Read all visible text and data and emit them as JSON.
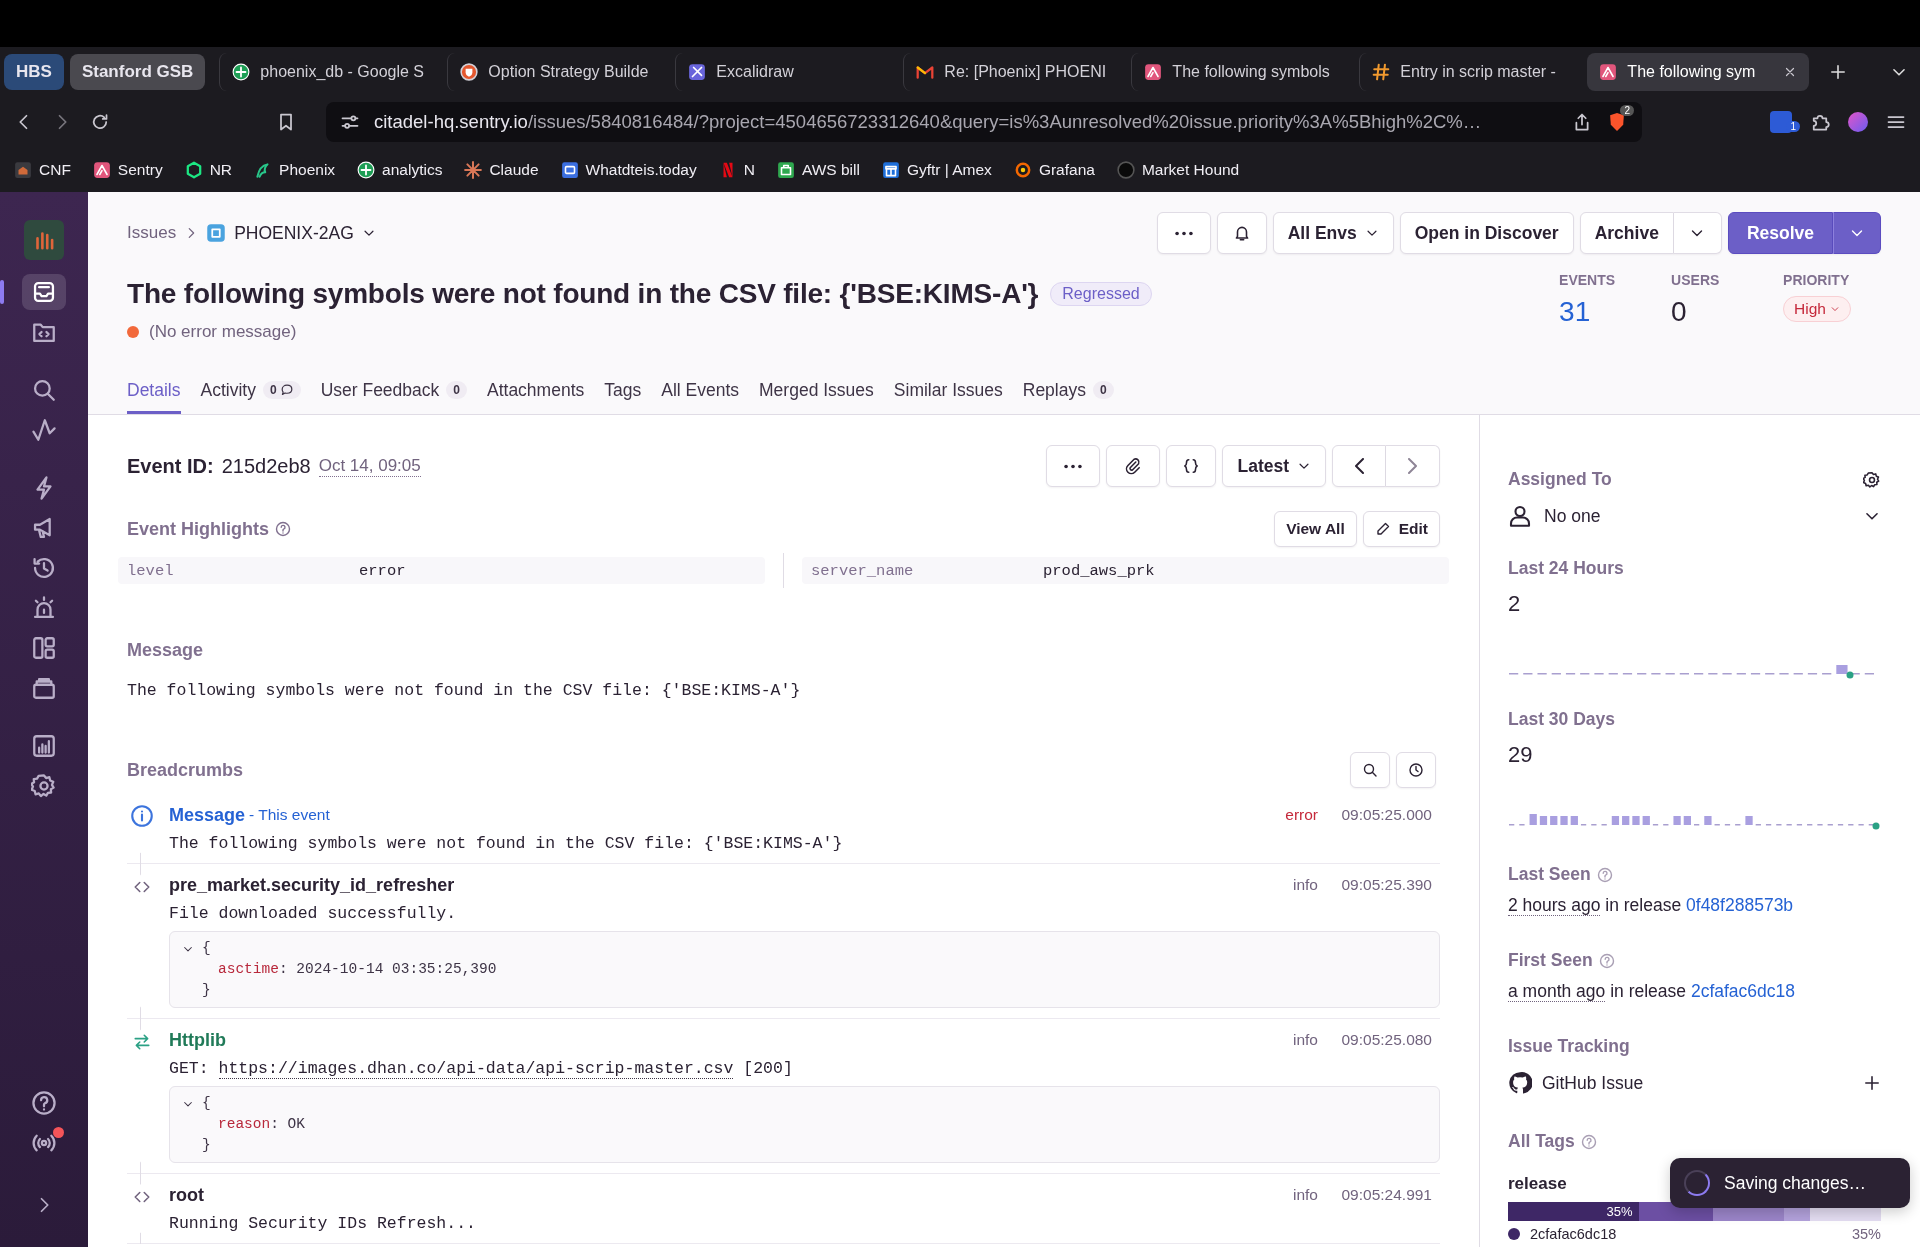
{
  "browser": {
    "tab_groups": [
      {
        "label": "HBS",
        "color": "#2b4a78"
      },
      {
        "label": "Stanford GSB",
        "color": "#4a494f"
      }
    ],
    "tabs": [
      {
        "title": "phoenix_db - Google S",
        "kind": "sheet",
        "selected": false
      },
      {
        "title": "Option Strategy Builde",
        "kind": "shield",
        "selected": false
      },
      {
        "title": "Excalidraw",
        "kind": "draw",
        "selected": false
      },
      {
        "title": "Re: [Phoenix] PHOENI",
        "kind": "mail",
        "selected": false
      },
      {
        "title": "The following symbols",
        "kind": "sentry",
        "selected": false
      },
      {
        "title": "Entry in scrip master -",
        "kind": "hash",
        "selected": false
      },
      {
        "title": "The following sym",
        "kind": "sentry",
        "selected": true
      }
    ],
    "address": {
      "host": "citadel-hq.sentry.io",
      "path": "/issues/5840816484/?project=4504656723312640&query=is%3Aunresolved%20issue.priority%3A%5Bhigh%2C%…"
    },
    "shield_badge": "2",
    "extension_badge": "1",
    "bookmarks": [
      {
        "label": "CNF",
        "kind": "house"
      },
      {
        "label": "Sentry",
        "kind": "sentry"
      },
      {
        "label": "NR",
        "kind": "nr"
      },
      {
        "label": "Phoenix",
        "kind": "phoenix"
      },
      {
        "label": "analytics",
        "kind": "sheet"
      },
      {
        "label": "Claude",
        "kind": "star"
      },
      {
        "label": "Whatdteis.today",
        "kind": "square"
      },
      {
        "label": "N",
        "kind": "redbar"
      },
      {
        "label": "AWS bill",
        "kind": "aws"
      },
      {
        "label": "Gyftr | Amex",
        "kind": "gift"
      },
      {
        "label": "Grafana",
        "kind": "gear"
      },
      {
        "label": "Market Hound",
        "kind": "circle"
      }
    ]
  },
  "sidebar": {
    "items": [
      {
        "kind": "issues",
        "selected": true
      },
      {
        "kind": "code",
        "selected": false
      },
      {
        "kind": "search",
        "selected": false
      },
      {
        "kind": "trend",
        "selected": false
      },
      {
        "kind": "bolt",
        "selected": false
      },
      {
        "kind": "megaphone",
        "selected": false
      },
      {
        "kind": "history",
        "selected": false
      },
      {
        "kind": "siren",
        "selected": false
      },
      {
        "kind": "panels",
        "selected": false
      },
      {
        "kind": "stack",
        "selected": false
      },
      {
        "kind": "chart",
        "selected": false
      },
      {
        "kind": "settings",
        "selected": false
      }
    ],
    "footer": [
      {
        "kind": "help",
        "alert": false
      },
      {
        "kind": "broadcast",
        "alert": true
      },
      {
        "kind": "expand",
        "alert": false
      }
    ]
  },
  "header": {
    "breadcrumb": "Issues",
    "issue_id": "PHOENIX-2AG",
    "environment": "All Envs",
    "buttons": [
      "Open in Discover",
      "Archive"
    ],
    "primary": "Resolve",
    "title": "The following symbols were not found in the CSV file: {'BSE:KIMS-A'}",
    "status": "Regressed",
    "subtitle": "(No error message)",
    "stats": [
      {
        "label": "EVENTS",
        "value": "31",
        "kind": "link"
      },
      {
        "label": "USERS",
        "value": "0",
        "kind": "plain"
      }
    ],
    "priority": {
      "label": "PRIORITY",
      "value": "High"
    }
  },
  "tabs": [
    {
      "label": "Details",
      "selected": true
    },
    {
      "label": "Activity",
      "count": "0",
      "kind": "comment",
      "selected": false
    },
    {
      "label": "User Feedback",
      "count": "0",
      "selected": false
    },
    {
      "label": "Attachments",
      "selected": false
    },
    {
      "label": "Tags",
      "selected": false
    },
    {
      "label": "All Events",
      "selected": false
    },
    {
      "label": "Merged Issues",
      "selected": false
    },
    {
      "label": "Similar Issues",
      "selected": false
    },
    {
      "label": "Replays",
      "count": "0",
      "selected": false
    }
  ],
  "event": {
    "id_label": "Event ID:",
    "id": "215d2eb8",
    "date": "Oct 14, 09:05",
    "selector": "Latest",
    "highlights_title": "Event Highlights",
    "highlight_buttons": [
      "View All",
      "Edit"
    ],
    "highlights": [
      {
        "key": "level",
        "value": "error"
      },
      {
        "key": "server_name",
        "value": "prod_aws_prk"
      }
    ],
    "message_title": "Message",
    "message": "The following symbols were not found in the CSV file: {'BSE:KIMS-A'}",
    "breadcrumbs_title": "Breadcrumbs",
    "breadcrumbs": [
      {
        "kind": "message",
        "title": "Message",
        "note": " - This event",
        "level": "error",
        "time": "09:05:25.000",
        "text": "The following symbols were not found in the CSV file: {'BSE:KIMS-A'}"
      },
      {
        "kind": "log",
        "title": "pre_market.security_id_refresher",
        "level": "info",
        "time": "09:05:25.390",
        "text": "File downloaded successfully.",
        "data": {
          "open": "{",
          "close": "}",
          "entries": [
            {
              "key": "asctime",
              "separator": ":",
              "value": "2024-10-14 03:35:25,390"
            }
          ]
        }
      },
      {
        "kind": "http",
        "title": "Httplib",
        "level": "info",
        "time": "09:05:25.080",
        "method": "GET: ",
        "url": "https://images.dhan.co/api-data/api-scrip-master.csv",
        "status": " [200]",
        "data": {
          "open": "{",
          "close": "}",
          "entries": [
            {
              "key": "reason",
              "separator": ":",
              "value": "OK"
            }
          ]
        }
      },
      {
        "kind": "log",
        "title": "root",
        "level": "info",
        "time": "09:05:24.991",
        "text": "Running Security IDs Refresh..."
      }
    ]
  },
  "side": {
    "assigned_title": "Assigned To",
    "assignee": "No one",
    "counts": [
      {
        "title": "Last 24 Hours",
        "value": "2",
        "kind": "day"
      },
      {
        "title": "Last 30 Days",
        "value": "29",
        "kind": "month"
      }
    ],
    "seen": [
      {
        "title": "Last Seen",
        "ago": "2 hours ago",
        "middle": " in release ",
        "release": "0f48f288573b"
      },
      {
        "title": "First Seen",
        "ago": "a month ago",
        "middle": " in release ",
        "release": "2cfafac6dc18"
      }
    ],
    "tracking_title": "Issue Tracking",
    "tracker": "GitHub Issue",
    "tags_title": "All Tags",
    "tag": "release",
    "tag_bar_label": "35%",
    "tag_value": "2cfafac6dc18",
    "tag_share": "35%"
  },
  "toast": "Saving changes…"
}
